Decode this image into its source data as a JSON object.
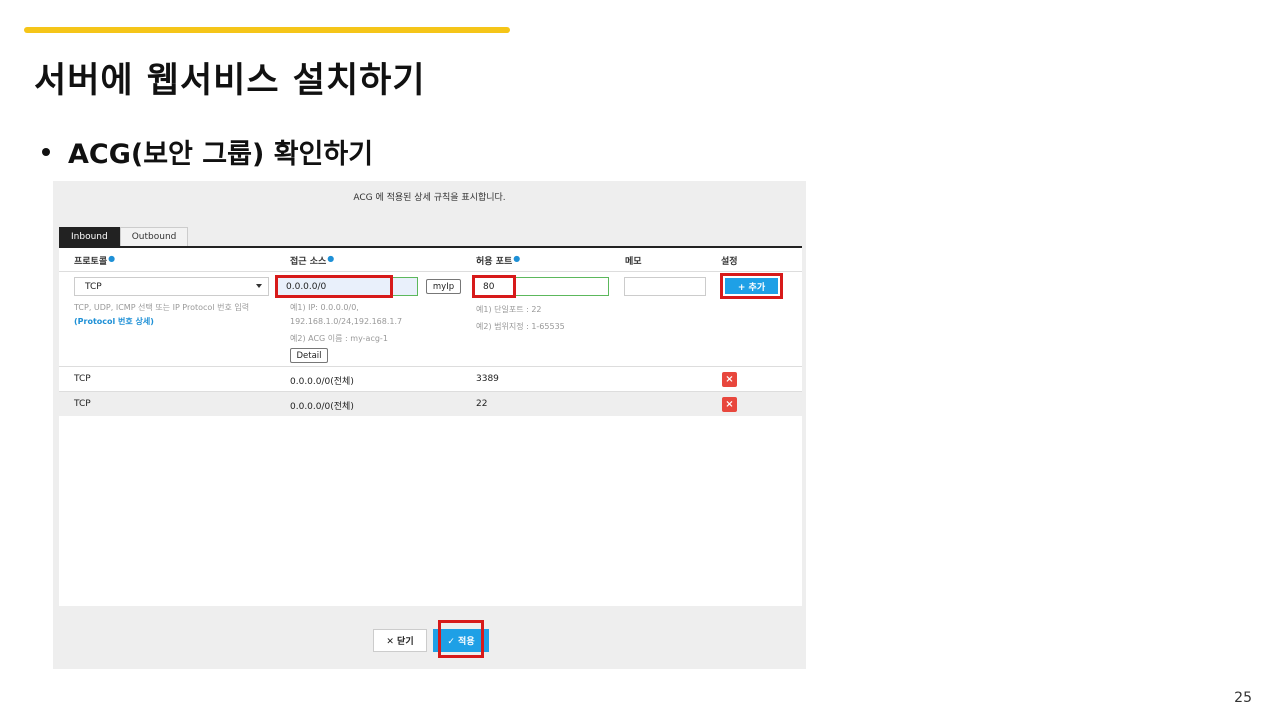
{
  "slide": {
    "title": "서버에 웹서비스 설치하기",
    "bullet": "ACG(보안 그룹) 확인하기",
    "page_number": "25",
    "accent_color": "#f5c518",
    "highlight_color": "#d71a1a"
  },
  "panel": {
    "header": "ACG 에 적용된 상세 규칙을 표시합니다.",
    "tabs": [
      {
        "label": "Inbound",
        "active": true
      },
      {
        "label": "Outbound",
        "active": false
      }
    ],
    "columns": {
      "protocol": "프로토콜",
      "source": "접근 소스",
      "port": "허용 포트",
      "memo": "메모",
      "settings": "설정"
    },
    "form": {
      "protocol_value": "TCP",
      "protocol_hint": "TCP, UDP, ICMP 선택 또는 IP Protocol 번호 입력",
      "protocol_link": "(Protocol 번호 상세)",
      "source_value": "0.0.0.0/0",
      "myip_label": "myIp",
      "source_hint_1": "예1) IP: 0.0.0.0/0,",
      "source_hint_2": "192.168.1.0/24,192.168.1.7",
      "source_hint_3": "예2) ACG 이름 : my-acg-1",
      "detail_label": "Detail",
      "port_value": "80",
      "port_hint_1": "예1) 단일포트 : 22",
      "port_hint_2": "예2) 범위지정 : 1-65535",
      "memo_value": "",
      "add_label": "+ 추가"
    },
    "rules": [
      {
        "protocol": "TCP",
        "source": "0.0.0.0/0(전체)",
        "port": "3389",
        "delete": "×"
      },
      {
        "protocol": "TCP",
        "source": "0.0.0.0/0(전체)",
        "port": "22",
        "delete": "×"
      }
    ],
    "footer": {
      "close_label": "✕ 닫기",
      "apply_label": "✓ 적용"
    },
    "button_color": "#1ea0e6",
    "delete_color": "#e8473d"
  }
}
